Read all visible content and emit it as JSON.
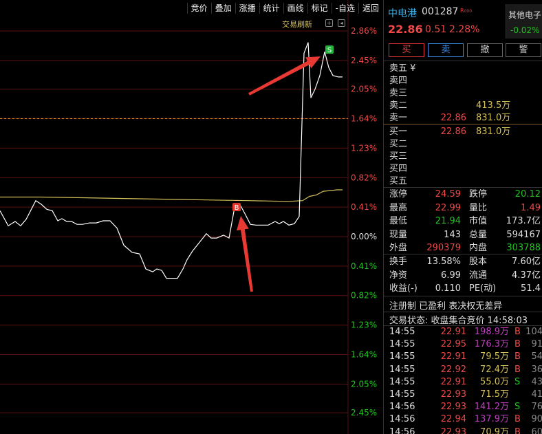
{
  "toolbar": [
    "竞价",
    "叠加",
    "涨播",
    "统计",
    "画线",
    "标记",
    "-自选",
    "返回"
  ],
  "trade_refresh": "交易刷新",
  "chart_data": {
    "type": "line",
    "y_axis_pct_labels": [
      "2.86%",
      "2.45%",
      "2.05%",
      "1.64%",
      "1.23%",
      "0.82%",
      "0.41%",
      "0.00%",
      "0.41%",
      "0.82%",
      "1.23%",
      "1.64%",
      "2.05%",
      "2.45%"
    ],
    "y_axis_pct_values": [
      2.86,
      2.45,
      2.05,
      1.64,
      1.23,
      0.82,
      0.41,
      0.0,
      -0.41,
      -0.82,
      -1.23,
      -1.64,
      -2.05,
      -2.45
    ],
    "ylim": [
      -2.6,
      3.0
    ],
    "series": [
      {
        "color": "#ffffff",
        "x": [
          0,
          12,
          22,
          30,
          38,
          45,
          52,
          60,
          68,
          76,
          84,
          90,
          97,
          104,
          112,
          120,
          130,
          140,
          150,
          160,
          170,
          180,
          192,
          203,
          212,
          222,
          228,
          235,
          242,
          250,
          258,
          266,
          272,
          280,
          290,
          300,
          307,
          315,
          325,
          333,
          340,
          348,
          356,
          364,
          372,
          380,
          390,
          400,
          406,
          412,
          420,
          428,
          435,
          442,
          448,
          452,
          458,
          465,
          472,
          478,
          484,
          492,
          498
        ],
        "y": [
          0.36,
          0.15,
          0.21,
          0.15,
          0.24,
          0.37,
          0.5,
          0.45,
          0.38,
          0.36,
          0.22,
          0.25,
          0.21,
          0.21,
          0.17,
          0.17,
          0.19,
          0.19,
          0.22,
          0.22,
          0.12,
          -0.12,
          -0.22,
          -0.24,
          -0.45,
          -0.49,
          -0.45,
          -0.47,
          -0.58,
          -0.58,
          -0.58,
          -0.45,
          -0.32,
          -0.2,
          -0.08,
          0.04,
          -0.02,
          -0.02,
          0.02,
          -0.02,
          0.35,
          0.46,
          0.32,
          0.17,
          0.16,
          0.16,
          0.16,
          0.21,
          0.18,
          0.21,
          0.16,
          0.18,
          0.28,
          2.55,
          2.7,
          1.93,
          2.05,
          2.24,
          2.57,
          2.35,
          2.24,
          2.22,
          2.22
        ]
      },
      {
        "color": "#d4c15a",
        "x": [
          0,
          60,
          120,
          180,
          240,
          300,
          360,
          420,
          440,
          450,
          460,
          470,
          480,
          490,
          498
        ],
        "y": [
          0.55,
          0.55,
          0.54,
          0.53,
          0.52,
          0.51,
          0.5,
          0.49,
          0.5,
          0.56,
          0.58,
          0.63,
          0.64,
          0.65,
          0.65
        ]
      }
    ],
    "reference_dashed_pct": 1.64,
    "markers": [
      {
        "label": "B",
        "x": 344,
        "y": 0.41,
        "color": "#e8382e"
      },
      {
        "label": "S",
        "x": 479,
        "y": 2.6,
        "color": "#22b53a"
      }
    ]
  },
  "stock": {
    "name": "中电港",
    "code": "001287",
    "badge": "R",
    "price": "22.86",
    "change": "0.51",
    "change_pct": "2.28%",
    "sector_name": "其他电子",
    "sector_change": "-0.02%"
  },
  "buttons": {
    "buy": "买",
    "sell": "卖",
    "cancel": "撤",
    "alert": "警"
  },
  "order_book": {
    "asks": [
      {
        "label": "卖五 ¥",
        "price": "",
        "volume": ""
      },
      {
        "label": "卖四",
        "price": "",
        "volume": ""
      },
      {
        "label": "卖三",
        "price": "",
        "volume": ""
      },
      {
        "label": "卖二",
        "price": "",
        "volume": "413.5万"
      },
      {
        "label": "卖一",
        "price": "22.86",
        "volume": "831.0万"
      }
    ],
    "bids": [
      {
        "label": "买一",
        "price": "22.86",
        "volume": "831.0万"
      },
      {
        "label": "买二",
        "price": "",
        "volume": ""
      },
      {
        "label": "买三",
        "price": "",
        "volume": ""
      },
      {
        "label": "买四",
        "price": "",
        "volume": ""
      },
      {
        "label": "买五",
        "price": "",
        "volume": ""
      }
    ]
  },
  "stats_block1": [
    [
      {
        "label": "涨停",
        "value": "24.59",
        "color": "#f04848"
      },
      {
        "label": "跌停",
        "value": "20.12",
        "color": "#22c322"
      }
    ],
    [
      {
        "label": "最高",
        "value": "22.99",
        "color": "#f04848"
      },
      {
        "label": "量比",
        "value": "1.49",
        "color": "#f04848"
      }
    ],
    [
      {
        "label": "最低",
        "value": "21.94",
        "color": "#22c322"
      },
      {
        "label": "市值",
        "value": "173.7亿",
        "color": "#ddd"
      }
    ],
    [
      {
        "label": "现量",
        "value": "143",
        "color": "#ddd"
      },
      {
        "label": "总量",
        "value": "594167",
        "color": "#ddd"
      }
    ],
    [
      {
        "label": "外盘",
        "value": "290379",
        "color": "#f04848"
      },
      {
        "label": "内盘",
        "value": "303788",
        "color": "#22c322"
      }
    ]
  ],
  "stats_block2": [
    [
      {
        "label": "换手",
        "value": "13.58%",
        "color": "#ddd"
      },
      {
        "label": "股本",
        "value": "7.60亿",
        "color": "#ddd"
      }
    ],
    [
      {
        "label": "净资",
        "value": "6.99",
        "color": "#ddd"
      },
      {
        "label": "流通",
        "value": "4.37亿",
        "color": "#ddd"
      }
    ],
    [
      {
        "label": "收益(-)",
        "value": "0.110",
        "color": "#ddd"
      },
      {
        "label": "PE(动)",
        "value": "51.4",
        "color": "#ddd"
      }
    ]
  ],
  "registration": "注册制 已盈利 表决权无差异",
  "trade_status": "交易状态: 收盘集合竞价 14:58:03",
  "ticks": [
    {
      "time": "14:55",
      "price": "22.91",
      "volume": "198.9万",
      "vcolor": "#c040c0",
      "side": "B",
      "count": "104"
    },
    {
      "time": "14:55",
      "price": "22.95",
      "volume": "176.3万",
      "vcolor": "#c040c0",
      "side": "B",
      "count": "91"
    },
    {
      "time": "14:55",
      "price": "22.91",
      "volume": "79.5万",
      "vcolor": "#d4c15a",
      "side": "B",
      "count": "54"
    },
    {
      "time": "14:55",
      "price": "22.92",
      "volume": "72.4万",
      "vcolor": "#d4c15a",
      "side": "B",
      "count": "36"
    },
    {
      "time": "14:55",
      "price": "22.91",
      "volume": "55.0万",
      "vcolor": "#d4c15a",
      "side": "S",
      "count": "43"
    },
    {
      "time": "14:55",
      "price": "22.93",
      "volume": "71.5万",
      "vcolor": "#d4c15a",
      "side": "",
      "count": "41"
    },
    {
      "time": "14:56",
      "price": "22.93",
      "volume": "141.2万",
      "vcolor": "#c040c0",
      "side": "S",
      "count": "76"
    },
    {
      "time": "14:56",
      "price": "22.94",
      "volume": "137.9万",
      "vcolor": "#c040c0",
      "side": "B",
      "count": "90"
    },
    {
      "time": "14:56",
      "price": "22.93",
      "volume": "70.9万",
      "vcolor": "#d4c15a",
      "side": "B",
      "count": "60"
    }
  ]
}
